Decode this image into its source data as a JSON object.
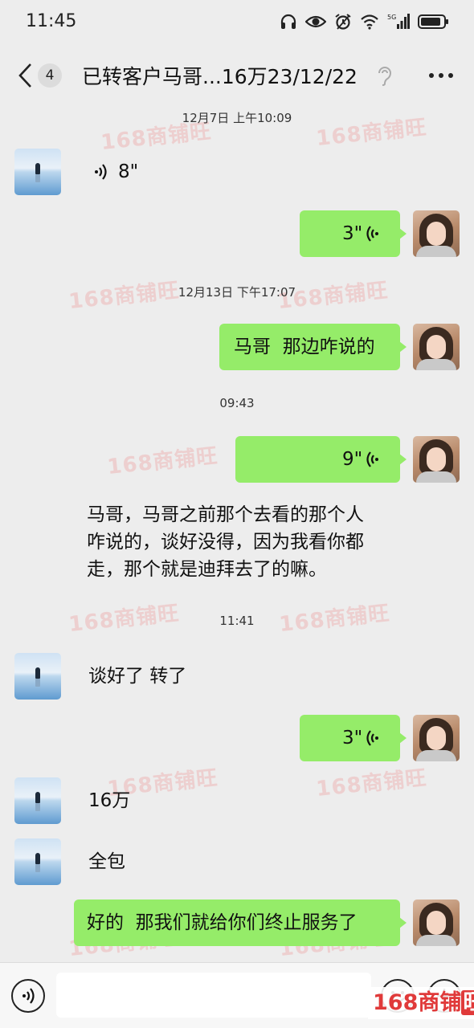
{
  "status_bar": {
    "time": "11:45",
    "network": "5G",
    "icons": [
      "headphones-icon",
      "eye-icon",
      "alarm-icon",
      "wifi-icon",
      "signal-icon",
      "battery-icon"
    ]
  },
  "nav": {
    "badge_count": "4",
    "title": "已转客户马哥...16万23/12/22",
    "icons": [
      "back-chevron-icon",
      "ear-icon",
      "more-dots-icon"
    ]
  },
  "messages": [
    {
      "kind": "timestamp",
      "text": "12月7日 上午10:09"
    },
    {
      "kind": "voice",
      "side": "left",
      "duration": "8\""
    },
    {
      "kind": "voice",
      "side": "right",
      "duration": "3\""
    },
    {
      "kind": "timestamp",
      "text": "12月13日 下午17:07"
    },
    {
      "kind": "text",
      "side": "right",
      "text": "马哥  那边咋说的"
    },
    {
      "kind": "timestamp",
      "text": "09:43"
    },
    {
      "kind": "voice",
      "side": "right",
      "duration": "9\""
    },
    {
      "kind": "transcript",
      "lines": [
        "马哥，马哥之前那个去看的那个人",
        "咋说的，谈好没得，因为我看你都",
        "走，那个就是迪拜去了的嘛。"
      ]
    },
    {
      "kind": "timestamp",
      "text": "11:41"
    },
    {
      "kind": "text",
      "side": "left",
      "text": "谈好了 转了"
    },
    {
      "kind": "voice",
      "side": "right",
      "duration": "3\""
    },
    {
      "kind": "text",
      "side": "left",
      "text": "16万"
    },
    {
      "kind": "text",
      "side": "left",
      "text": "全包"
    },
    {
      "kind": "text",
      "side": "right",
      "text": "好的  那我们就给你们终止服务了"
    }
  ],
  "watermark": "168商铺旺",
  "input_bar": {
    "placeholder": "",
    "brand_prefix": "168商铺",
    "brand_suffix": "旺"
  },
  "colors": {
    "background": "#ededed",
    "bubble_green": "#95ec69",
    "watermark": "#eb6464"
  }
}
